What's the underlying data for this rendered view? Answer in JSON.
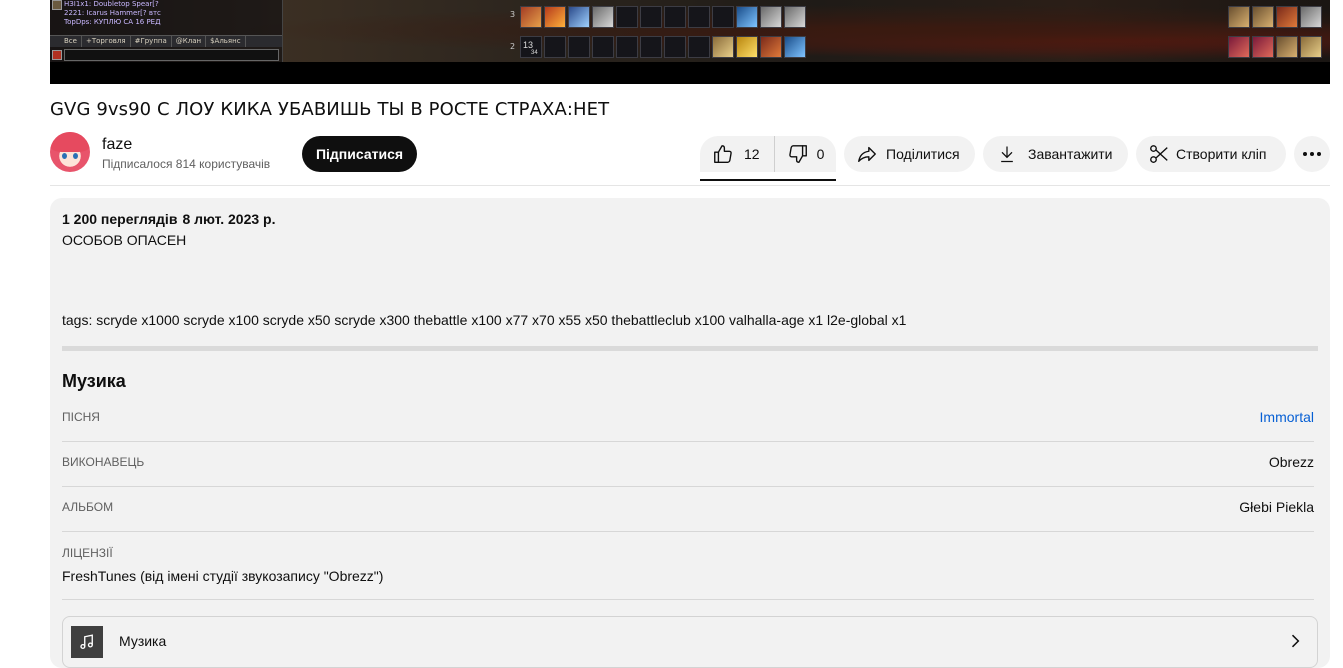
{
  "video": {
    "chat_lines": [
      {
        "text": "НЗI1x1: Doubletop Spear[?",
        "color": "#c9b8ff"
      },
      {
        "text": "2221: Icarus Hammer[?  втс",
        "color": "#c9b8ff"
      },
      {
        "text": "TopDps: КУПЛЮ СА 16 РЕД",
        "color": "#c9b8ff"
      }
    ],
    "chat_tabs": [
      "Все",
      "+Торговля",
      "#Группа",
      "@Клан",
      "$Альянс"
    ],
    "hotbar_top_index": "3",
    "hotbar_bottom_index": "2",
    "hotbar_bottom_count": "13",
    "hotbar_bottom_sub": "34"
  },
  "title": "GVG 9vs90 С ЛОУ КИКА УБАВИШЬ ТЫ В РОСТЕ СТРАХА:НЕТ",
  "channel": {
    "name": "faze",
    "subscribers": "Підписалося 814 користувачів",
    "subscribe_label": "Підписатися"
  },
  "actions": {
    "likes": "12",
    "dislikes": "0",
    "share": "Поділитися",
    "download": "Завантажити",
    "clip": "Створити кліп"
  },
  "description": {
    "views": "1 200 переглядів",
    "date": "8 лют. 2023 р.",
    "line1": "ОСОБОВ ОПАСЕН",
    "tags": "tags: scryde x1000 scryde x100 scryde x50 scryde x300 thebattle x100 x77 x70 x55 x50 thebattleclub x100 valhalla-age x1 l2e-global x1"
  },
  "music": {
    "heading": "Музика",
    "rows": {
      "song": {
        "label": "Пісня",
        "value": "Immortal"
      },
      "artist": {
        "label": "Виконавець",
        "value": "Obrezz"
      },
      "album": {
        "label": "Альбом",
        "value": "Głebi Piekla"
      },
      "license": {
        "label": "Ліцензії",
        "value": "FreshTunes (від імені студії звукозапису \"Obrezz\")"
      }
    },
    "card_title": "Музика"
  },
  "colors": {
    "link": "#065fd4",
    "subscribe_bg": "#0f0f0f",
    "pill_bg": "#f2f2f2"
  }
}
